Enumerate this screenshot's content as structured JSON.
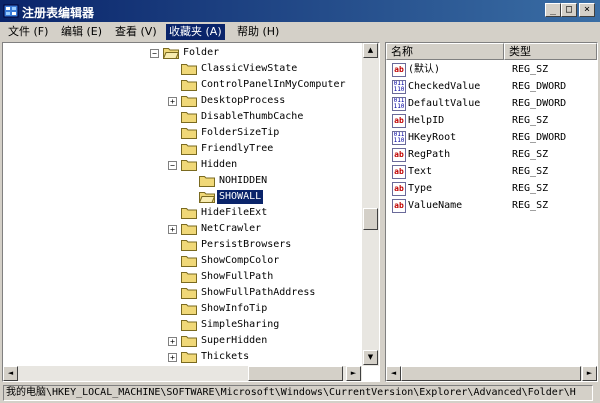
{
  "window": {
    "title": "注册表编辑器",
    "min_glyph": "_",
    "max_glyph": "□",
    "close_glyph": "×"
  },
  "menu": [
    {
      "label": "文件 (F)"
    },
    {
      "label": "编辑 (E)"
    },
    {
      "label": "查看 (V)"
    },
    {
      "label": "收藏夹 (A)",
      "active": true
    },
    {
      "label": "帮助 (H)"
    }
  ],
  "tree": {
    "root": {
      "label": "Folder",
      "expander": "−"
    },
    "children": [
      {
        "label": "ClassicViewState",
        "expander": ""
      },
      {
        "label": "ControlPanelInMyComputer",
        "expander": ""
      },
      {
        "label": "DesktopProcess",
        "expander": "+"
      },
      {
        "label": "DisableThumbCache",
        "expander": ""
      },
      {
        "label": "FolderSizeTip",
        "expander": ""
      },
      {
        "label": "FriendlyTree",
        "expander": ""
      },
      {
        "label": "Hidden",
        "expander": "−"
      },
      {
        "label": "NOHIDDEN",
        "expander": "",
        "sub": true
      },
      {
        "label": "SHOWALL",
        "expander": "",
        "sub": true,
        "selected": true
      },
      {
        "label": "HideFileExt",
        "expander": ""
      },
      {
        "label": "NetCrawler",
        "expander": "+"
      },
      {
        "label": "PersistBrowsers",
        "expander": ""
      },
      {
        "label": "ShowCompColor",
        "expander": ""
      },
      {
        "label": "ShowFullPath",
        "expander": ""
      },
      {
        "label": "ShowFullPathAddress",
        "expander": ""
      },
      {
        "label": "ShowInfoTip",
        "expander": ""
      },
      {
        "label": "SimpleSharing",
        "expander": ""
      },
      {
        "label": "SuperHidden",
        "expander": "+"
      },
      {
        "label": "Thickets",
        "expander": "+"
      }
    ]
  },
  "list": {
    "col_name": "名称",
    "col_type": "类型",
    "rows": [
      {
        "name": "(默认)",
        "type": "REG_SZ",
        "icon": "string-value-icon",
        "glyph": "ab"
      },
      {
        "name": "CheckedValue",
        "type": "REG_DWORD",
        "icon": "dword-value-icon",
        "glyph": "011 110"
      },
      {
        "name": "DefaultValue",
        "type": "REG_DWORD",
        "icon": "dword-value-icon",
        "glyph": "011 110"
      },
      {
        "name": "HelpID",
        "type": "REG_SZ",
        "icon": "string-value-icon",
        "glyph": "ab"
      },
      {
        "name": "HKeyRoot",
        "type": "REG_DWORD",
        "icon": "dword-value-icon",
        "glyph": "011 110"
      },
      {
        "name": "RegPath",
        "type": "REG_SZ",
        "icon": "string-value-icon",
        "glyph": "ab"
      },
      {
        "name": "Text",
        "type": "REG_SZ",
        "icon": "string-value-icon",
        "glyph": "ab"
      },
      {
        "name": "Type",
        "type": "REG_SZ",
        "icon": "string-value-icon",
        "glyph": "ab"
      },
      {
        "name": "ValueName",
        "type": "REG_SZ",
        "icon": "string-value-icon",
        "glyph": "ab"
      }
    ]
  },
  "scroll": {
    "left_up": "▲",
    "left_down": "▼",
    "left_right": "►",
    "left_left": "◄"
  },
  "status": {
    "path": "我的电脑\\HKEY_LOCAL_MACHINE\\SOFTWARE\\Microsoft\\Windows\\CurrentVersion\\Explorer\\Advanced\\Folder\\H"
  },
  "colors": {
    "title_from": "#0a246a",
    "title_to": "#3a6ea5",
    "selection": "#0a246a",
    "folder": "#f0d878"
  }
}
